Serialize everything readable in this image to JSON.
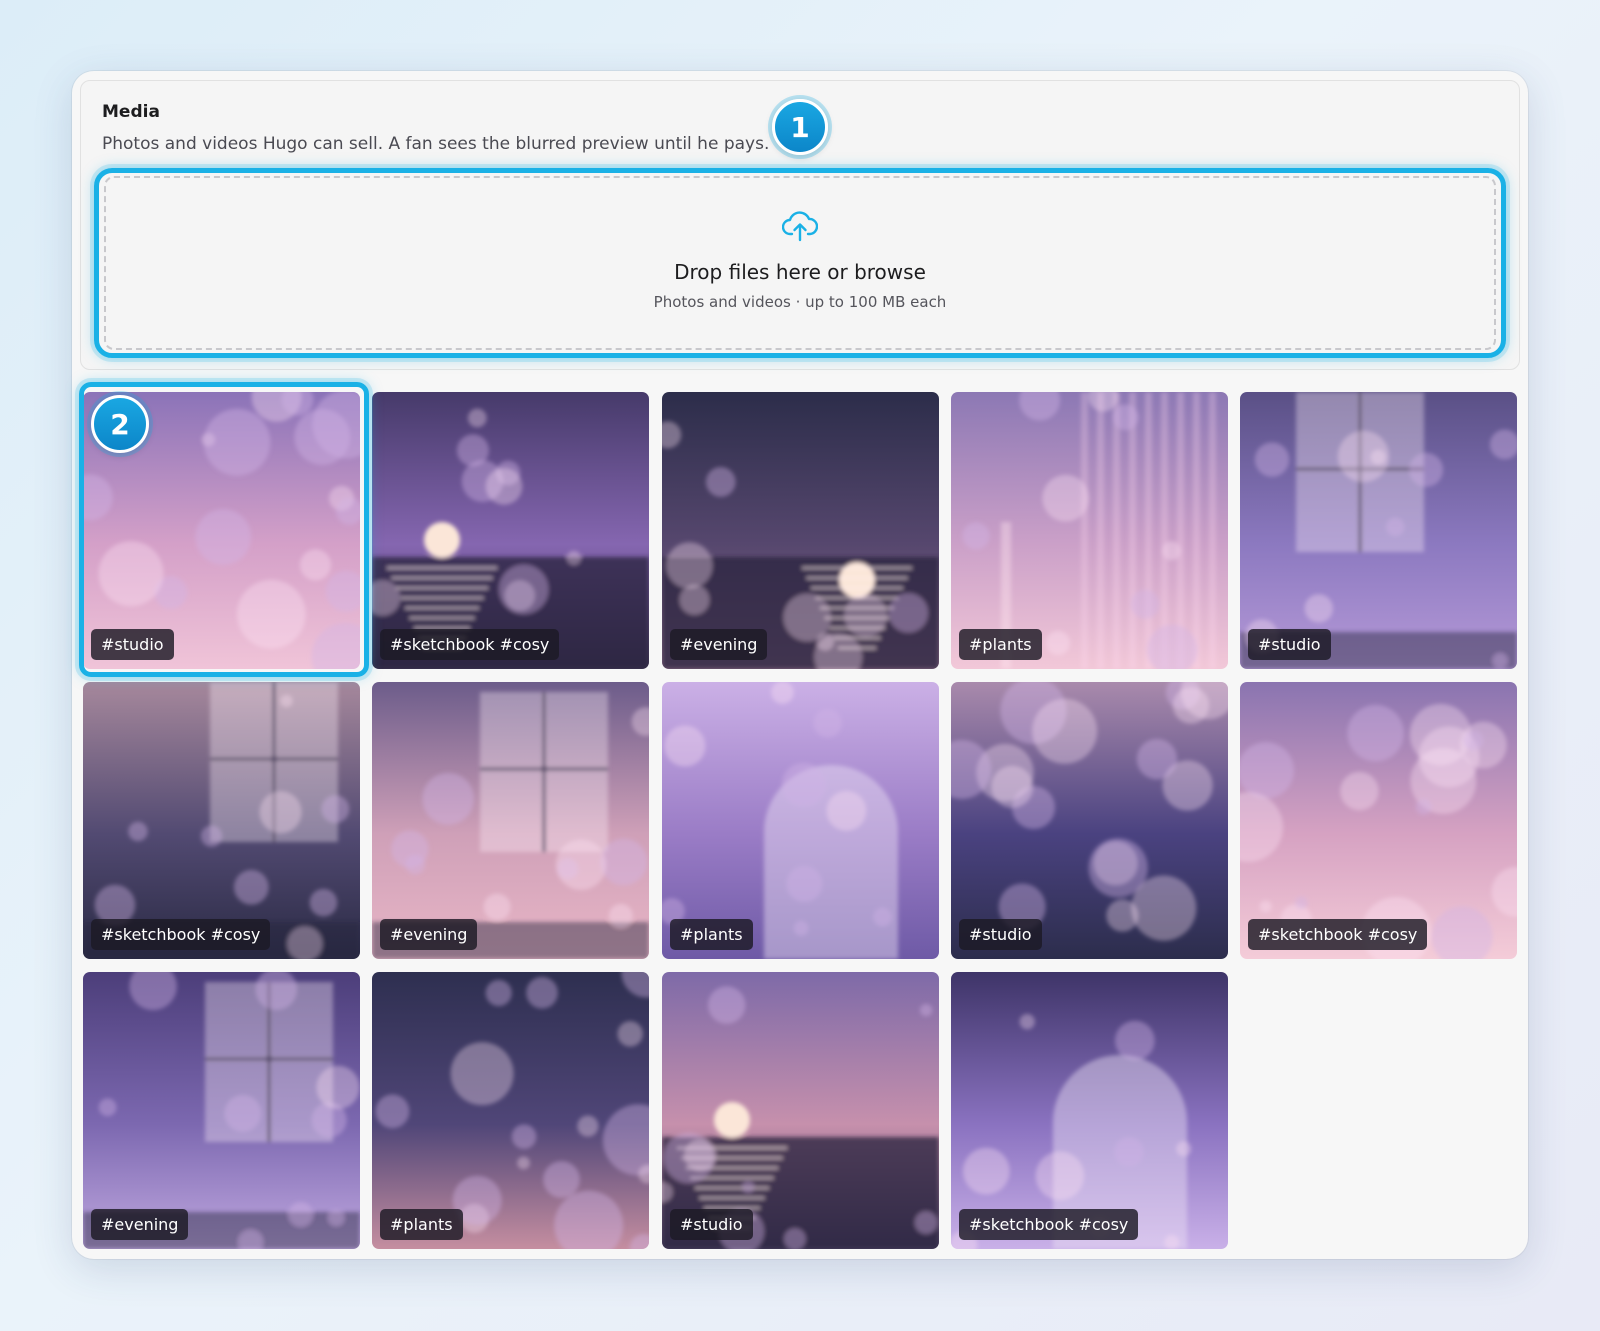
{
  "media": {
    "title": "Media",
    "subtitle": "Photos and videos Hugo can sell. A fan sees the blurred preview until he pays."
  },
  "dropzone": {
    "title": "Drop files here or browse",
    "hint": "Photos and videos · up to 100 MB each",
    "icon": "cloud-upload-icon"
  },
  "callouts": [
    "1",
    "2"
  ],
  "colors": {
    "accent": "#1ab1e6",
    "callout": "#0c86c9",
    "tag_bg": "#1c1a24"
  },
  "gallery": {
    "items": [
      {
        "tag": "#studio"
      },
      {
        "tag": "#sketchbook #cosy"
      },
      {
        "tag": "#evening"
      },
      {
        "tag": "#plants"
      },
      {
        "tag": "#studio"
      },
      {
        "tag": "#sketchbook #cosy"
      },
      {
        "tag": "#evening"
      },
      {
        "tag": "#plants"
      },
      {
        "tag": "#studio"
      },
      {
        "tag": "#sketchbook #cosy"
      },
      {
        "tag": "#evening"
      },
      {
        "tag": "#plants"
      },
      {
        "tag": "#studio"
      },
      {
        "tag": "#sketchbook #cosy"
      }
    ]
  }
}
